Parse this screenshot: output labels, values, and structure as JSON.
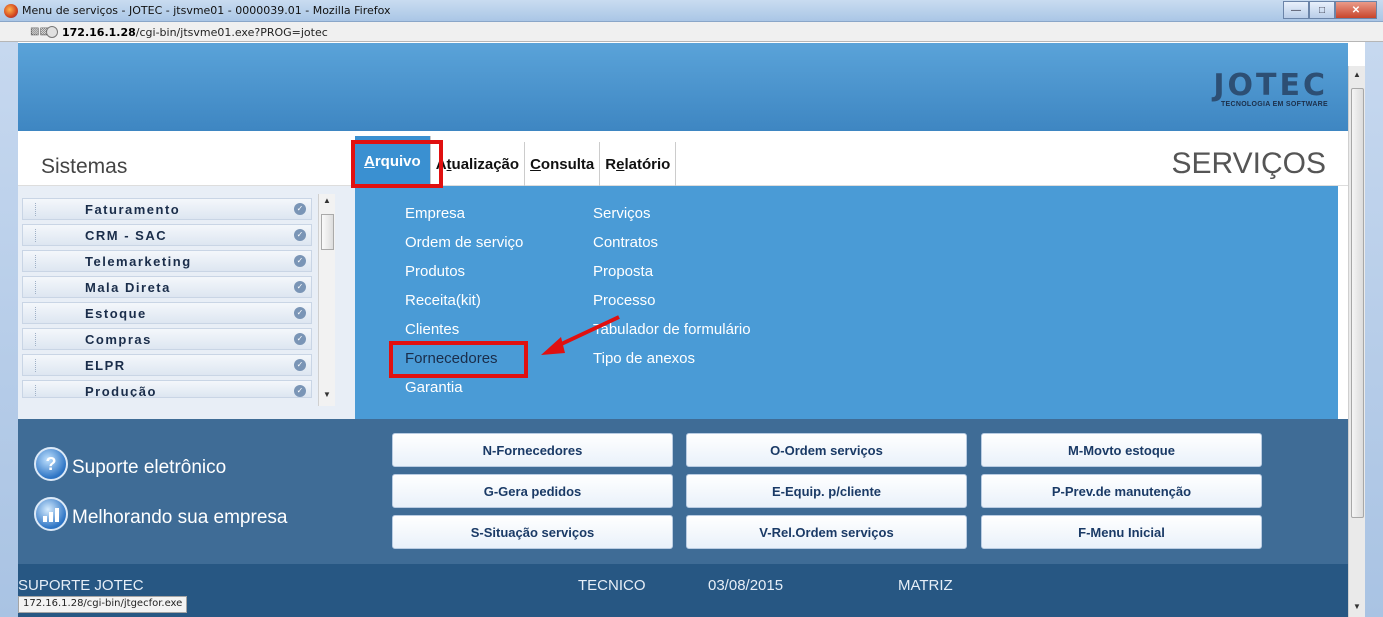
{
  "window": {
    "title": "Menu de serviços - JOTEC - jtsvme01 - 0000039.01 - Mozilla Firefox"
  },
  "address": {
    "host": "172.16.1.28",
    "path": "/cgi-bin/jtsvme01.exe?PROG=jotec"
  },
  "logo": {
    "main": "JOTEC",
    "sub": "TECNOLOGIA EM SOFTWARE"
  },
  "nav": {
    "sistemas": "Sistemas",
    "menu": [
      {
        "mnemonic": "A",
        "rest": "rquivo"
      },
      {
        "pre": "A",
        "mnemonic": "t",
        "rest": "ualização"
      },
      {
        "mnemonic": "C",
        "rest": "onsulta"
      },
      {
        "pre": "R",
        "mnemonic": "e",
        "rest": "latório"
      }
    ],
    "module_title": "SERVIÇOS"
  },
  "sidebar": {
    "items": [
      "Faturamento",
      "CRM - SAC",
      "Telemarketing",
      "Mala Direta",
      "Estoque",
      "Compras",
      "ELPR",
      "Produção"
    ]
  },
  "dropdown": {
    "col1": [
      "Empresa",
      "Ordem de serviço",
      "Produtos",
      "Receita(kit)",
      "Clientes",
      "Fornecedores",
      "Garantia"
    ],
    "col2": [
      "Serviços",
      "Contratos",
      "Proposta",
      "Processo",
      "Tabulador de formulário",
      "Tipo de anexos"
    ]
  },
  "support": {
    "line1": "Suporte eletrônico",
    "line2": "Melhorando sua empresa"
  },
  "buttons": [
    [
      "N-Fornecedores",
      "O-Ordem serviços",
      "M-Movto estoque"
    ],
    [
      "G-Gera pedidos",
      "E-Equip. p/cliente",
      "P-Prev.de manutenção"
    ],
    [
      "S-Situação serviços",
      "V-Rel.Ordem serviços",
      "F-Menu Inicial"
    ]
  ],
  "footer": {
    "left": "SUPORTE JOTEC",
    "user": "TECNICO",
    "date": "03/08/2015",
    "branch": "MATRIZ"
  },
  "statusbar": "172.16.1.28/cgi-bin/jtgecfor.exe",
  "colors": {
    "accent": "#3a90d1",
    "highlight": "#e01010",
    "footer": "#275783"
  }
}
